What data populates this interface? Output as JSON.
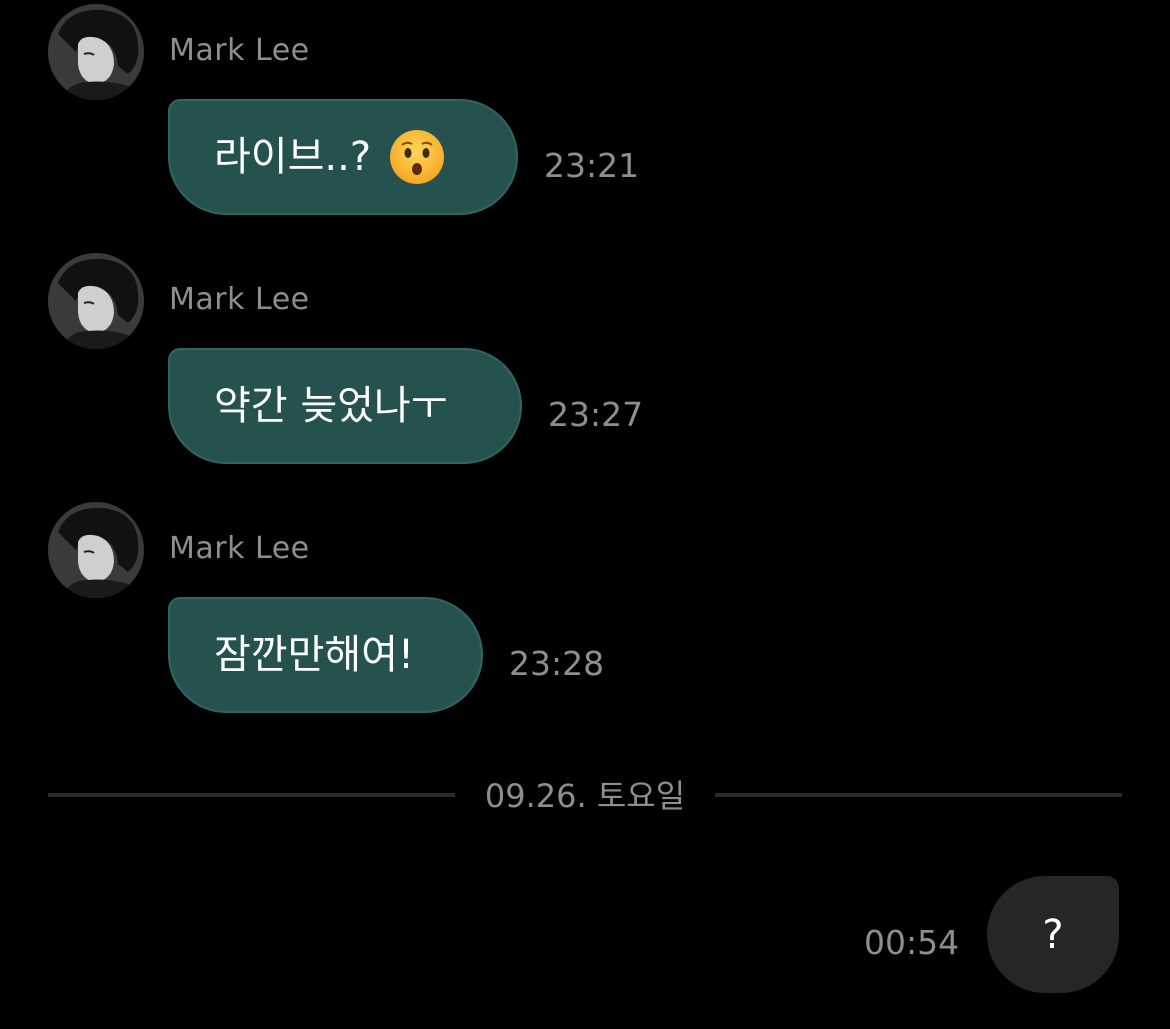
{
  "messages": [
    {
      "sender": "Mark Lee",
      "text": "라이브..?",
      "emoji": "hushed-face-icon",
      "time": "23:21"
    },
    {
      "sender": "Mark Lee",
      "text": "약간 늦었나ㅜ",
      "time": "23:27"
    },
    {
      "sender": "Mark Lee",
      "text": "잠깐만해여!",
      "time": "23:28"
    }
  ],
  "date_divider": "09.26. 토요일",
  "my_messages": [
    {
      "text": "?",
      "time": "00:54"
    }
  ],
  "colors": {
    "background": "#000000",
    "incoming_bubble": "#25524f",
    "outgoing_bubble": "#262626",
    "meta_text": "#8e8e8e"
  }
}
